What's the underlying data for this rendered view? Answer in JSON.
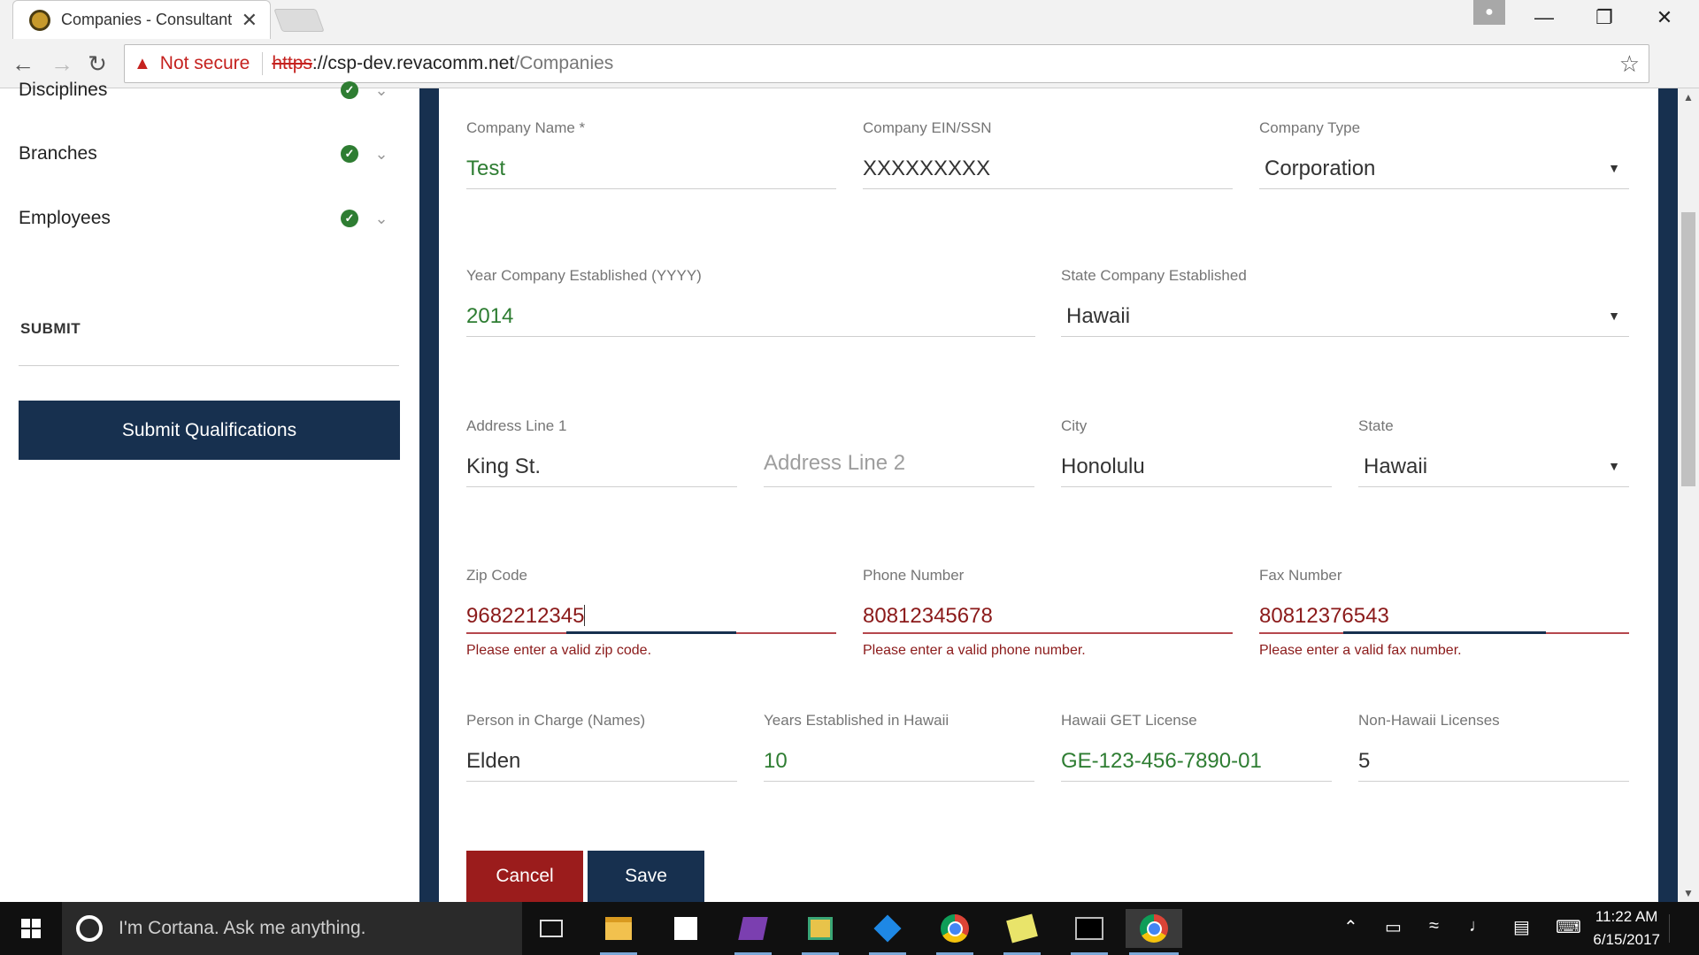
{
  "browser": {
    "tab_title": "Companies - Consultant",
    "tab_close": "✕",
    "not_secure": "Not secure",
    "url_scheme": "https",
    "url_sep": "://",
    "url_host": "csp-dev.revacomm.net",
    "url_path": "/Companies"
  },
  "sidebar": {
    "items": [
      {
        "label": "Disciplines"
      },
      {
        "label": "Branches"
      },
      {
        "label": "Employees"
      }
    ],
    "submit_heading": "SUBMIT",
    "submit_button": "Submit Qualifications"
  },
  "form": {
    "company_name": {
      "label": "Company Name *",
      "value": "Test"
    },
    "company_ein": {
      "label": "Company EIN/SSN",
      "value": "XXXXXXXXX"
    },
    "company_type": {
      "label": "Company Type",
      "value": "Corporation"
    },
    "year_established": {
      "label": "Year Company Established (YYYY)",
      "value": "2014"
    },
    "state_established": {
      "label": "State Company Established",
      "value": "Hawaii"
    },
    "address1": {
      "label": "Address Line 1",
      "value": "King St."
    },
    "address2": {
      "placeholder": "Address Line 2"
    },
    "city": {
      "label": "City",
      "value": "Honolulu"
    },
    "state": {
      "label": "State",
      "value": "Hawaii"
    },
    "zip": {
      "label": "Zip Code",
      "value": "9682212345",
      "error": "Please enter a valid zip code."
    },
    "phone": {
      "label": "Phone Number",
      "value": "80812345678",
      "error": "Please enter a valid phone number."
    },
    "fax": {
      "label": "Fax Number",
      "value": "80812376543",
      "error": "Please enter a valid fax number."
    },
    "person_in_charge": {
      "label": "Person in Charge (Names)",
      "value": "Elden"
    },
    "years_in_hawaii": {
      "label": "Years Established in Hawaii",
      "value": "10"
    },
    "get_license": {
      "label": "Hawaii GET License",
      "value": "GE-123-456-7890-01"
    },
    "non_hawaii_licenses": {
      "label": "Non-Hawaii Licenses",
      "value": "5"
    },
    "cancel_button": "Cancel",
    "save_button": "Save"
  },
  "taskbar": {
    "cortana_placeholder": "I'm Cortana. Ask me anything.",
    "time": "11:22 AM",
    "date": "6/15/2017"
  },
  "colors": {
    "navy": "#17304f",
    "error_red": "#8b1a1a",
    "valid_green": "#2e7d32",
    "cancel_red": "#9b1c1c"
  },
  "icons": {
    "favicon": "company-logo-icon",
    "check": "check-circle-icon",
    "chevron": "chevron-down-icon",
    "dropdown": "caret-down-icon"
  }
}
